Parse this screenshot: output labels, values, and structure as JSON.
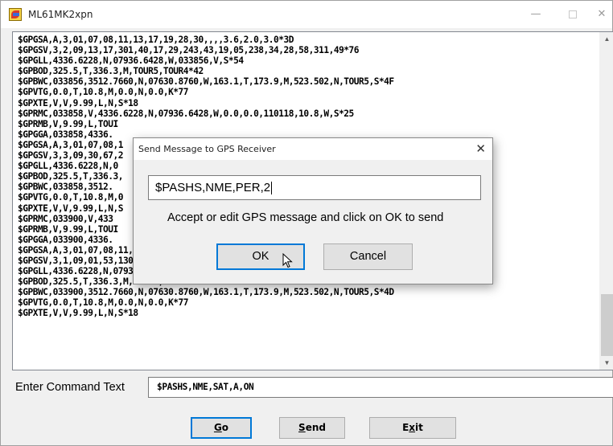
{
  "window": {
    "title": "ML61MK2xpn",
    "controls": {
      "minimize": "—",
      "maximize": "",
      "close": "✕"
    }
  },
  "log": {
    "lines": [
      "$GPGSA,A,3,01,07,08,11,13,17,19,28,30,,,,3.6,2.0,3.0*3D",
      "$GPGSV,3,2,09,13,17,301,40,17,29,243,43,19,05,238,34,28,58,311,49*76",
      "$GPGLL,4336.6228,N,07936.6428,W,033856,V,S*54",
      "$GPBOD,325.5,T,336.3,M,TOUR5,TOUR4*42",
      "$GPBWC,033856,3512.7660,N,07630.8760,W,163.1,T,173.9,M,523.502,N,TOUR5,S*4F",
      "$GPVTG,0.0,T,10.8,M,0.0,N,0.0,K*77",
      "$GPXTE,V,V,9.99,L,N,S*18",
      "$GPRMC,033858,V,4336.6228,N,07936.6428,W,0.0,0.0,110118,10.8,W,S*25",
      "$GPRMB,V,9.99,L,TOUI",
      "$GPGGA,033858,4336.",
      "$GPGSA,A,3,01,07,08,1",
      "$GPGSV,3,3,09,30,67,2",
      "$GPGLL,4336.6228,N,0",
      "$GPBOD,325.5,T,336.3,",
      "$GPBWC,033858,3512.",
      "$GPVTG,0.0,T,10.8,M,0",
      "$GPXTE,V,V,9.99,L,N,S",
      "$GPRMC,033900,V,433",
      "$GPRMB,V,9.99,L,TOUI",
      "$GPGGA,033900,4336.",
      "$GPGSA,A,3,01,07,08,11,13,17,19,28,30,,,,3.6,2.0,3.0*3D",
      "$GPGSV,3,1,09,01,53,130,48,07,49,181,47,08,31,056,44,11,68,102,50*7B",
      "$GPGLL,4336.6228,N,07936.6428,W,033900,V,S*56",
      "$GPBOD,325.5,T,336.3,M,TOUR5,TOUR4*42",
      "$GPBWC,033900,3512.7660,N,07630.8760,W,163.1,T,173.9,M,523.502,N,TOUR5,S*4D",
      "$GPVTG,0.0,T,10.8,M,0.0,N,0.0,K*77",
      "$GPXTE,V,V,9.99,L,N,S*18"
    ]
  },
  "command": {
    "label": "Enter Command Text",
    "value": "$PASHS,NME,SAT,A,ON"
  },
  "buttons": {
    "go": {
      "underlined": "G",
      "rest": "o"
    },
    "send": {
      "underlined": "S",
      "rest": "end"
    },
    "exit": {
      "prefix": "E",
      "underlined": "x",
      "rest": "it"
    }
  },
  "dialog": {
    "title": "Send Message to GPS Receiver",
    "close": "✕",
    "input_value": "$PASHS,NME,PER,2",
    "message": "Accept or edit GPS message and click on OK to send",
    "ok_label": "OK",
    "cancel_label": "Cancel"
  }
}
